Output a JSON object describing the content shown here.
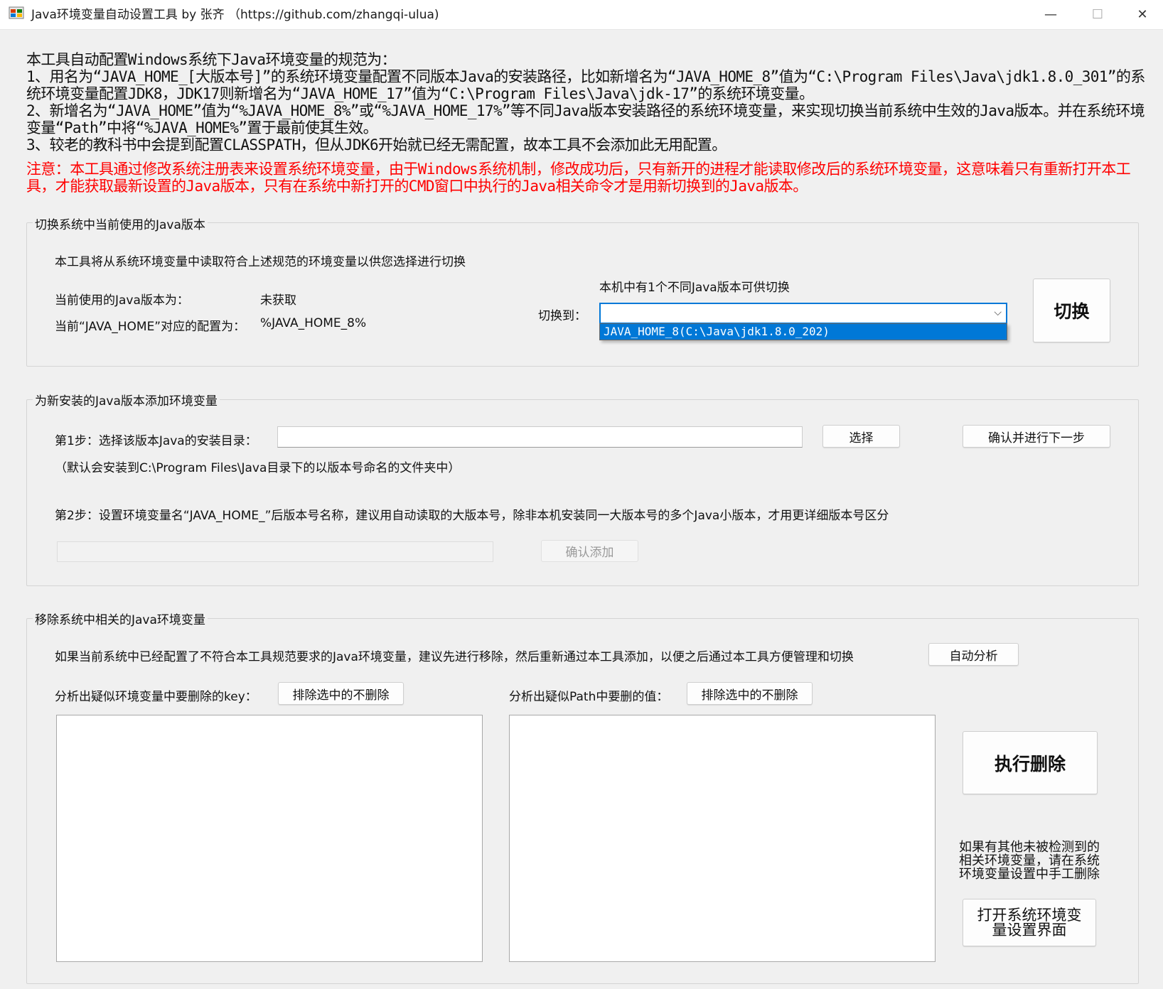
{
  "window": {
    "title": "Java环境变量自动设置工具 by 张齐  （https://github.com/zhangqi-ulua)",
    "controls": {
      "minimize": "—",
      "maximize": "☐",
      "close": "✕"
    }
  },
  "intro": {
    "text": "本工具自动配置Windows系统下Java环境变量的规范为：\n1、用名为“JAVA_HOME_[大版本号]”的系统环境变量配置不同版本Java的安装路径，比如新增名为“JAVA_HOME_8”值为“C:\\Program Files\\Java\\jdk1.8.0_301”的系统环境变量配置JDK8，JDK17则新增名为“JAVA_HOME_17”值为“C:\\Program Files\\Java\\jdk-17”的系统环境变量。\n2、新增名为“JAVA_HOME”值为“%JAVA_HOME_8%”或“%JAVA_HOME_17%”等不同Java版本安装路径的系统环境变量，来实现切换当前系统中生效的Java版本。并在系统环境变量“Path”中将“%JAVA_HOME%”置于最前使其生效。\n3、较老的教科书中会提到配置CLASSPATH，但从JDK6开始就已经无需配置，故本工具不会添加此无用配置。",
    "notice": "注意：本工具通过修改系统注册表来设置系统环境变量，由于Windows系统机制，修改成功后，只有新开的进程才能读取修改后的系统环境变量，这意味着只有重新打开本工具，才能获取最新设置的Java版本，只有在系统中新打开的CMD窗口中执行的Java相关命令才是用新切换到的Java版本。"
  },
  "switch_group": {
    "title": "切换系统中当前使用的Java版本",
    "desc": "本工具将从系统环境变量中读取符合上述规范的环境变量以供您选择进行切换",
    "current_label": "当前使用的Java版本为：",
    "current_value": "未获取",
    "java_home_label": "当前“JAVA_HOME”对应的配置为：",
    "java_home_value": "%JAVA_HOME_8%",
    "available_text": "本机中有1个不同Java版本可供切换",
    "switch_to_label": "切换到：",
    "combo_value": "",
    "combo_options": [
      "JAVA_HOME_8(C:\\Java\\jdk1.8.0_202)"
    ],
    "switch_button": "切换"
  },
  "add_group": {
    "title": "为新安装的Java版本添加环境变量",
    "step1_label": "第1步：选择该版本Java的安装目录：",
    "step1_value": "",
    "select_button": "选择",
    "next_button": "确认并进行下一步",
    "default_hint": "（默认会安装到C:\\Program Files\\Java目录下的以版本号命名的文件夹中）",
    "step2_label": "第2步：设置环境变量名“JAVA_HOME_”后版本号名称，建议用自动读取的大版本号，除非本机安装同一大版本号的多个Java小版本，才用更详细版本号区分",
    "step2_value": "",
    "confirm_add_button": "确认添加"
  },
  "remove_group": {
    "title": "移除系统中相关的Java环境变量",
    "desc": "如果当前系统中已经配置了不符合本工具规范要求的Java环境变量，建议先进行移除，然后重新通过本工具添加，以便之后通过本工具方便管理和切换",
    "auto_analyze_button": "自动分析",
    "keys_label": "分析出疑似环境变量中要删除的key：",
    "keys_exclude_button": "排除选中的不删除",
    "path_label": "分析出疑似Path中要删的值：",
    "path_exclude_button": "排除选中的不删除",
    "keys_list": [],
    "path_list": [],
    "execute_delete_button": "执行删除",
    "manual_hint": "如果有其他未被检测到的相关环境变量，请在系统环境变量设置中手工删除",
    "open_settings_button": "打开系统环境变量设置界面"
  }
}
